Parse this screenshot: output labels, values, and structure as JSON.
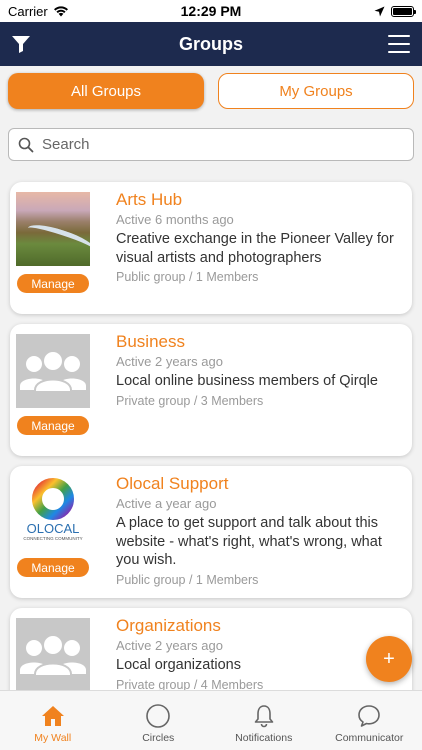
{
  "status_bar": {
    "carrier": "Carrier",
    "time": "12:29 PM"
  },
  "header": {
    "title": "Groups",
    "filter_icon": "filter-icon",
    "menu_icon": "hamburger-menu-icon"
  },
  "tabs": [
    {
      "label": "All Groups",
      "active": true
    },
    {
      "label": "My Groups",
      "active": false
    }
  ],
  "search": {
    "placeholder": "Search"
  },
  "groups": [
    {
      "name": "Arts Hub",
      "active": "Active 6 months ago",
      "description": "Creative exchange in the Pioneer Valley for visual artists and photographers",
      "meta": "Public group / 1 Members",
      "manage_label": "Manage"
    },
    {
      "name": "Business",
      "active": "Active 2 years ago",
      "description": "Local online business members of Qirqle",
      "meta": "Private group / 3 Members",
      "manage_label": "Manage"
    },
    {
      "name": "Olocal Support",
      "active": "Active a year ago",
      "description": "A place to get support and talk about this website - what's right, what's wrong, what you wish.",
      "meta": "Public group / 1 Members",
      "manage_label": "Manage",
      "logo_text": "OLOCAL",
      "logo_subtext": "CONNECTING COMMUNITY"
    },
    {
      "name": "Organizations",
      "active": "Active 2 years ago",
      "description": "Local organizations",
      "meta": "Private group / 4 Members"
    }
  ],
  "fab": {
    "label": "+"
  },
  "bottom_nav": [
    {
      "label": "My Wall",
      "icon": "home-icon",
      "active": true
    },
    {
      "label": "Circles",
      "icon": "circle-icon",
      "active": false
    },
    {
      "label": "Notifications",
      "icon": "bell-icon",
      "active": false
    },
    {
      "label": "Communicator",
      "icon": "chat-bubble-icon",
      "active": false
    }
  ],
  "colors": {
    "accent": "#f0821e",
    "header_bg": "#1d2a4e"
  }
}
